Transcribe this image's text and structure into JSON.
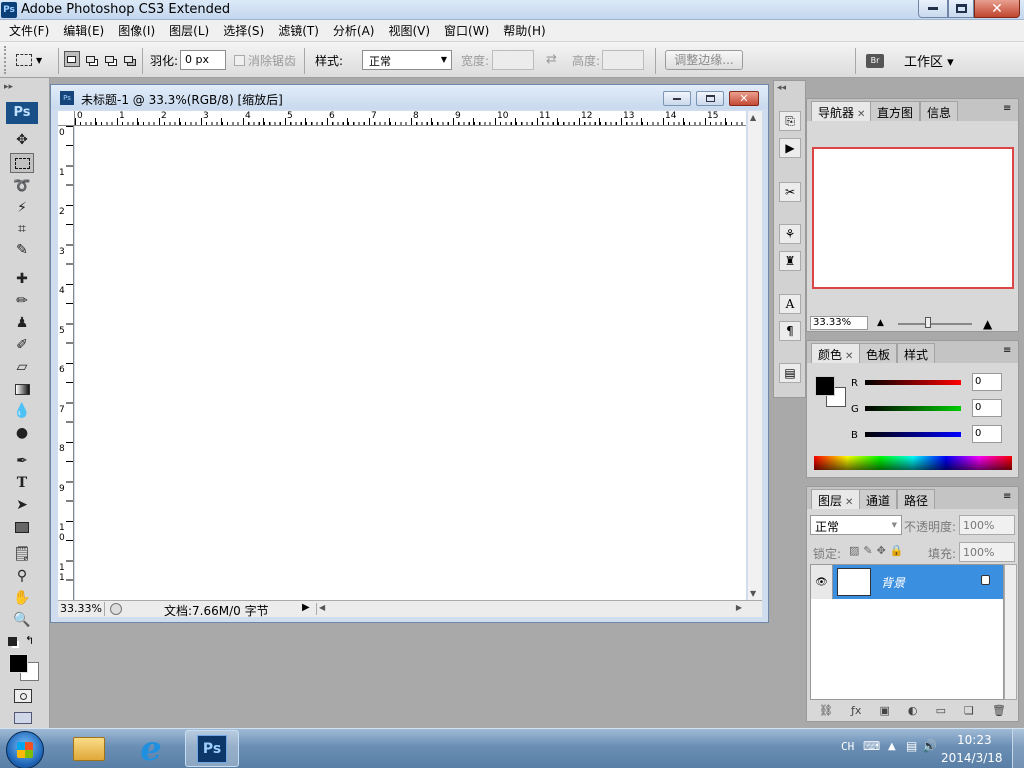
{
  "window": {
    "title": "Adobe Photoshop CS3 Extended",
    "logo": "Ps"
  },
  "menu": [
    "文件(F)",
    "编辑(E)",
    "图像(I)",
    "图层(L)",
    "选择(S)",
    "滤镜(T)",
    "分析(A)",
    "视图(V)",
    "窗口(W)",
    "帮助(H)"
  ],
  "options": {
    "feather_label": "羽化:",
    "feather_value": "0 px",
    "antialias_label": "消除锯齿",
    "style_label": "样式:",
    "style_value": "正常",
    "width_label": "宽度:",
    "height_label": "高度:",
    "refine_edge": "调整边缘...",
    "workspace": "工作区 ▾"
  },
  "toolbox": {
    "logo": "Ps"
  },
  "document": {
    "title": "未标题-1 @ 33.3%(RGB/8) [缩放后]",
    "icon": "Ps",
    "zoom": "33.33%",
    "doc_info": "文档:7.66M/0 字节",
    "ruler_top": [
      "0",
      "1",
      "2",
      "3",
      "4",
      "5",
      "6",
      "7",
      "8",
      "9",
      "10",
      "11",
      "12",
      "13",
      "14",
      "15"
    ],
    "ruler_left": [
      "0",
      "1",
      "2",
      "3",
      "4",
      "5",
      "6",
      "7",
      "8",
      "9",
      "1\n0",
      "1\n1"
    ]
  },
  "navigator": {
    "tabs": [
      "导航器",
      "直方图",
      "信息"
    ],
    "zoom": "33.33%"
  },
  "color": {
    "tabs": [
      "颜色",
      "色板",
      "样式"
    ],
    "r_label": "R",
    "g_label": "G",
    "b_label": "B",
    "r_value": "0",
    "g_value": "0",
    "b_value": "0",
    "fg": "#000000",
    "bg": "#ffffff"
  },
  "layers": {
    "tabs": [
      "图层",
      "通道",
      "路径"
    ],
    "blend_mode": "正常",
    "opacity_label": "不透明度:",
    "opacity_value": "100%",
    "lock_label": "锁定:",
    "fill_label": "填充:",
    "fill_value": "100%",
    "layer_name": "背景"
  },
  "taskbar": {
    "ime": "CH",
    "time": "10:23",
    "date": "2014/3/18"
  }
}
